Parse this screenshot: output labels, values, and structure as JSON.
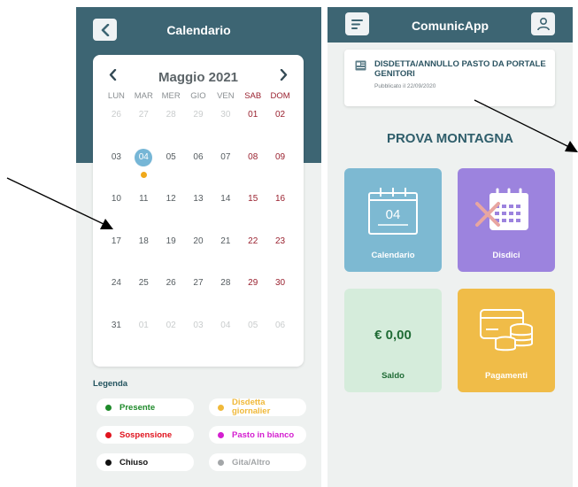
{
  "left_screen": {
    "header_title": "Calendario",
    "back_icon": "chevron-left-icon",
    "calendar": {
      "month_label": "Maggio 2021",
      "prev_icon": "chevron-left-icon",
      "next_icon": "chevron-right-icon",
      "weekdays": [
        "LUN",
        "MAR",
        "MER",
        "GIO",
        "VEN",
        "SAB",
        "DOM"
      ],
      "days": [
        {
          "label": "26",
          "state": "muted"
        },
        {
          "label": "27",
          "state": "muted"
        },
        {
          "label": "28",
          "state": "muted"
        },
        {
          "label": "29",
          "state": "muted"
        },
        {
          "label": "30",
          "state": "muted"
        },
        {
          "label": "01",
          "state": "weekend"
        },
        {
          "label": "02",
          "state": "weekend"
        },
        {
          "label": "03",
          "state": "normal"
        },
        {
          "label": "04",
          "state": "today",
          "dot": "#f0a91a"
        },
        {
          "label": "05",
          "state": "normal"
        },
        {
          "label": "06",
          "state": "normal"
        },
        {
          "label": "07",
          "state": "normal"
        },
        {
          "label": "08",
          "state": "weekend"
        },
        {
          "label": "09",
          "state": "weekend"
        },
        {
          "label": "10",
          "state": "normal"
        },
        {
          "label": "11",
          "state": "normal"
        },
        {
          "label": "12",
          "state": "normal"
        },
        {
          "label": "13",
          "state": "normal"
        },
        {
          "label": "14",
          "state": "normal"
        },
        {
          "label": "15",
          "state": "weekend"
        },
        {
          "label": "16",
          "state": "weekend"
        },
        {
          "label": "17",
          "state": "normal"
        },
        {
          "label": "18",
          "state": "normal"
        },
        {
          "label": "19",
          "state": "normal"
        },
        {
          "label": "20",
          "state": "normal"
        },
        {
          "label": "21",
          "state": "normal"
        },
        {
          "label": "22",
          "state": "weekend"
        },
        {
          "label": "23",
          "state": "weekend"
        },
        {
          "label": "24",
          "state": "normal"
        },
        {
          "label": "25",
          "state": "normal"
        },
        {
          "label": "26",
          "state": "normal"
        },
        {
          "label": "27",
          "state": "normal"
        },
        {
          "label": "28",
          "state": "normal"
        },
        {
          "label": "29",
          "state": "weekend"
        },
        {
          "label": "30",
          "state": "weekend"
        },
        {
          "label": "31",
          "state": "normal"
        },
        {
          "label": "01",
          "state": "muted"
        },
        {
          "label": "02",
          "state": "muted"
        },
        {
          "label": "03",
          "state": "muted"
        },
        {
          "label": "04",
          "state": "muted"
        },
        {
          "label": "05",
          "state": "muted"
        },
        {
          "label": "06",
          "state": "muted"
        }
      ]
    },
    "legend": {
      "title": "Legenda",
      "items": [
        {
          "label": "Presente",
          "color": "#1e8a2a",
          "wrap": false
        },
        {
          "label": "Disdetta giornalier",
          "color": "#f0b93a",
          "wrap": true
        },
        {
          "label": "Sospensione",
          "color": "#e0141e",
          "wrap": false
        },
        {
          "label": "Pasto in bianco",
          "color": "#d41fd0",
          "wrap": false
        },
        {
          "label": "Chiuso",
          "color": "#111111",
          "wrap": false
        },
        {
          "label": "Gita/Altro",
          "color": "#a3a6a8",
          "wrap": false
        }
      ]
    }
  },
  "right_screen": {
    "header_title": "ComunicApp",
    "menu_icon": "menu-icon",
    "user_icon": "user-icon",
    "news": {
      "icon": "newspaper-icon",
      "title": "DISDETTA/ANNULLO PASTO DA PORTALE GENITORI",
      "date": "Pubblicato il 22/09/2020"
    },
    "school_name": "PROVA MONTAGNA",
    "tiles": {
      "calendar": {
        "label": "Calendario",
        "icon": "calendar-icon",
        "day": "04",
        "color": "#7db9d2"
      },
      "cancel": {
        "label": "Disdici",
        "icon": "calendar-cancel-icon",
        "color": "#9c83de"
      },
      "balance": {
        "label": "Saldo",
        "amount": "€ 0,00",
        "color": "#d5ecdb"
      },
      "payments": {
        "label": "Pagamenti",
        "icon": "payment-card-coins-icon",
        "color": "#f0bc48"
      }
    }
  },
  "annotations": {
    "arrow_icons": [
      "arrow-annotation-left",
      "arrow-annotation-right"
    ]
  }
}
